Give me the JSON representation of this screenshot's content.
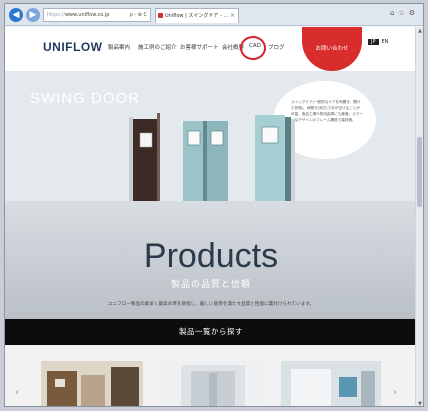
{
  "browser": {
    "address_prefix": "https://",
    "address_host": "www.uniflow.co.jp",
    "address_tools": "ρ - ⊕ C",
    "tab_title": "Uniflow | スイングドア - ...",
    "tab_close": "×"
  },
  "site": {
    "logo": "UNIFLOW",
    "nav": [
      "製品案内",
      "施工例のご紹介",
      "お客様サポート",
      "会社概要",
      "CAD",
      "ブログ"
    ],
    "contact_button": "お問い合わせ",
    "lang_jp": "JP",
    "lang_en": "EN"
  },
  "hero": {
    "title": "SWING DOOR",
    "speech": "スイングドア(一般的なドアを両開き、開けた状態)、両開き(両方)で手が空けることが可能、食品工場や物流倉庫にも最適、スマートなデザインのフレーム構造で高評価。"
  },
  "products": {
    "title": "Products",
    "subtitle": "製品の品質と信頼",
    "description": "ユニフロー製品の素早く最高水準を目指し、厳しい基準を満たす品質と性能に裏付けられています。",
    "search_button": "製品一覧から探す"
  },
  "colors": {
    "accent_red": "#d92c2c",
    "highlight_circle": "#d8202a",
    "logo_navy": "#1f3a5c"
  }
}
